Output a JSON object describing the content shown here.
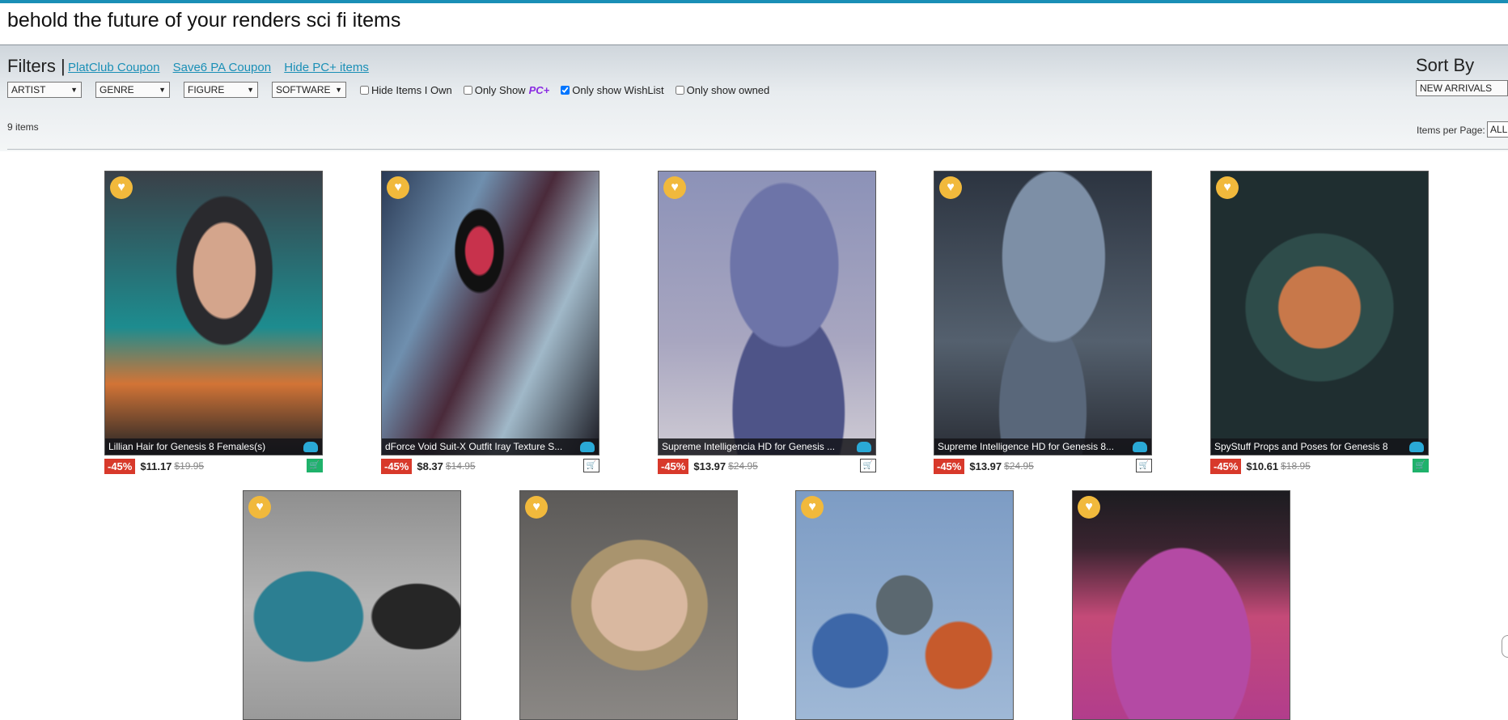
{
  "search": {
    "title": "behold the future of your renders sci fi items"
  },
  "filters": {
    "label": "Filters |",
    "links": [
      "PlatClub Coupon",
      "Save6 PA Coupon",
      "Hide PC+ items"
    ],
    "dropdowns": [
      "ARTIST",
      "GENRE",
      "FIGURE",
      "SOFTWARE"
    ],
    "checkboxes": [
      {
        "label": "Hide Items I Own",
        "checked": false
      },
      {
        "label": "Only Show",
        "checked": false,
        "badge": "PC+"
      },
      {
        "label": "Only show WishList",
        "checked": true
      },
      {
        "label": "Only show owned",
        "checked": false
      }
    ],
    "items_count": "9 items"
  },
  "sort": {
    "label": "Sort By",
    "value": "NEW ARRIVALS",
    "per_page_label": "Items per Page:",
    "per_page_value": "ALL"
  },
  "colors": {
    "accent": "#1a8fb6",
    "discount": "#d8392b",
    "heart": "#f1b93c",
    "owned": "#1fb26b"
  },
  "products": [
    {
      "title": "Lillian Hair for Genesis 8 Females(s)",
      "discount": "-45%",
      "price": "$11.17",
      "old_price": "$19.95",
      "owned": true
    },
    {
      "title": "dForce Void Suit-X Outfit Iray Texture S...",
      "discount": "-45%",
      "price": "$8.37",
      "old_price": "$14.95",
      "owned": false
    },
    {
      "title": "Supreme Intelligencia HD for Genesis ...",
      "discount": "-45%",
      "price": "$13.97",
      "old_price": "$24.95",
      "owned": false
    },
    {
      "title": "Supreme Intelligence HD for Genesis 8...",
      "discount": "-45%",
      "price": "$13.97",
      "old_price": "$24.95",
      "owned": false
    },
    {
      "title": "SpyStuff Props and Poses for Genesis 8",
      "discount": "-45%",
      "price": "$10.61",
      "old_price": "$18.95",
      "owned": true
    },
    {
      "title": "",
      "discount": "",
      "price": "",
      "old_price": "",
      "owned": false
    },
    {
      "title": "",
      "discount": "",
      "price": "",
      "old_price": "",
      "owned": false
    },
    {
      "title": "",
      "discount": "",
      "price": "",
      "old_price": "",
      "owned": false
    },
    {
      "title": "",
      "discount": "",
      "price": "",
      "old_price": "",
      "owned": false
    }
  ]
}
